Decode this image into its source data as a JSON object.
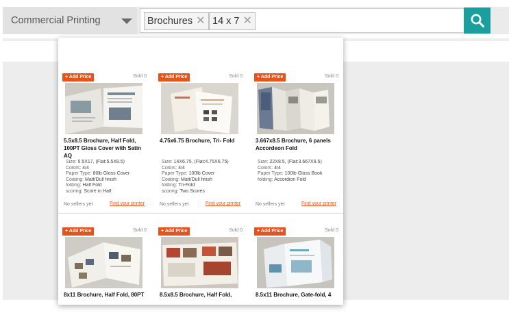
{
  "category": {
    "label": "Commercial Printing"
  },
  "search": {
    "tags": [
      {
        "label": "Brochures"
      },
      {
        "label": "14 x 7"
      }
    ]
  },
  "products": [
    {
      "add_price": "+ Add Price",
      "sold": "Sold  0",
      "title": "5.5x8.5 Brochure, Half Fold, 100PT Gloss Cover with Satin AQ",
      "specs": [
        {
          "label": "Size:",
          "value": "5.5X17, (Flat:5.5X8.5)"
        },
        {
          "label": "Colors:",
          "value": "4/4"
        },
        {
          "label": "Paper Type:",
          "value": "80lb Gloss Cover"
        },
        {
          "label": "Coating:",
          "value": "Matt/Dull finish"
        },
        {
          "label": "folding:",
          "value": "Half Fold"
        },
        {
          "label": "scoring:",
          "value": "Score in Half"
        }
      ],
      "no_sellers": "No sellers yet",
      "find_printer": "Find your printer"
    },
    {
      "add_price": "+ Add Price",
      "sold": "Sold  0",
      "title": "4.75x6.75 Brochure, Tri- Fold",
      "specs": [
        {
          "label": "Size:",
          "value": "14X6.75, (Flat:4.75X6.75)"
        },
        {
          "label": "Colors:",
          "value": "4/4"
        },
        {
          "label": "Paper Type:",
          "value": "100lb Cover"
        },
        {
          "label": "Coating:",
          "value": "Matt/Dull finish"
        },
        {
          "label": "folding:",
          "value": "Tri-Fold"
        },
        {
          "label": "scoring:",
          "value": "Two Scores"
        }
      ],
      "no_sellers": "No sellers yet",
      "find_printer": "Find your printer"
    },
    {
      "add_price": "+ Add Price",
      "sold": "Sold  0",
      "title": "3.667x8.5 Brochure, 6 panels Accordeon Fold",
      "specs": [
        {
          "label": "Size:",
          "value": "22X8.5, (Flat:3.667X8.5)"
        },
        {
          "label": "Colors:",
          "value": "4/4"
        },
        {
          "label": "Paper Type:",
          "value": "100lb Gloss Book"
        },
        {
          "label": "folding:",
          "value": "Accordion Fold"
        }
      ],
      "no_sellers": "No sellers yet",
      "find_printer": "Find your printer"
    },
    {
      "add_price": "+ Add Price",
      "sold": "Sold  0",
      "title": "8x11 Brochure, Half Fold, 80PT"
    },
    {
      "add_price": "+ Add Price",
      "sold": "Sold  0",
      "title": "8.5x8.5 Brochure, Half Fold,"
    },
    {
      "add_price": "+ Add Price",
      "sold": "Sold  0",
      "title": "8.5x11 Brochure, Gate-fold, 4"
    }
  ],
  "colors": {
    "accent": "#1a9e9e",
    "add_price": "#e8531c"
  },
  "icons": {
    "dropdown": "chevron-down-icon",
    "search": "search-icon",
    "remove_tag": "close-icon"
  }
}
